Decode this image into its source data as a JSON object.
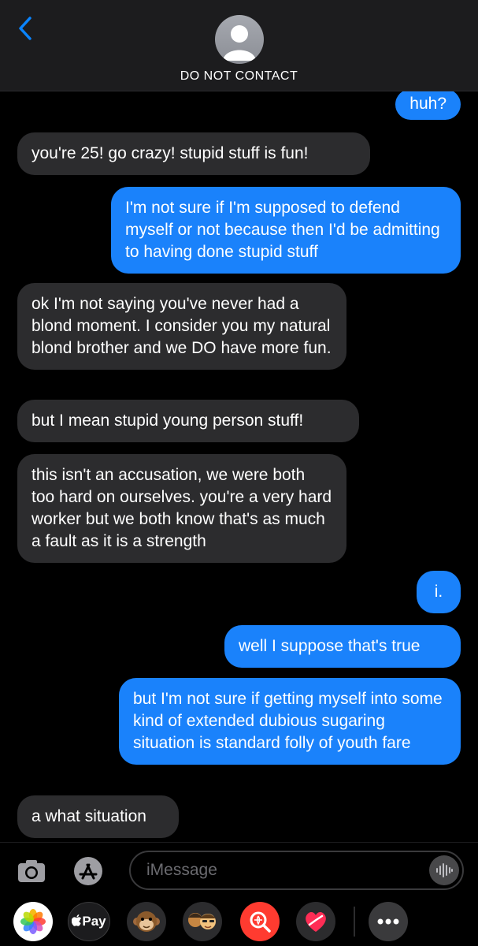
{
  "header": {
    "contact_name": "DO NOT CONTACT"
  },
  "messages": [
    {
      "from": "me",
      "text": "huh?"
    },
    {
      "from": "them",
      "text": "you're 25! go crazy! stupid stuff is fun!"
    },
    {
      "from": "me",
      "text": "I'm not sure if I'm supposed to defend myself or not because then I'd be admitting to having done stupid stuff"
    },
    {
      "from": "them",
      "text": "ok I'm not saying you've never had a blond moment. I consider you my natural blond brother and we DO have more fun."
    },
    {
      "from": "them",
      "text": "but I mean stupid young person stuff!"
    },
    {
      "from": "them",
      "text": "this isn't an accusation, we were both too hard on ourselves. you're a very hard worker but we both know that's as much a fault as it is a strength"
    },
    {
      "from": "me",
      "text": "i."
    },
    {
      "from": "me",
      "text": "well I suppose that's true"
    },
    {
      "from": "me",
      "text": "but I'm not sure if getting myself into some kind of extended dubious sugaring situation is standard folly of youth fare"
    },
    {
      "from": "them",
      "text": "a what situation"
    }
  ],
  "compose": {
    "placeholder": "iMessage"
  },
  "apps": {
    "apple_pay_label": "Pay"
  },
  "colors": {
    "outgoing_bubble": "#1a82fb",
    "incoming_bubble": "#2c2c2e",
    "header_bg": "#1c1c1e",
    "accent": "#0a84ff"
  },
  "icons": [
    "back-chevron-icon",
    "contact-avatar-icon",
    "camera-icon",
    "app-store-icon",
    "audio-waveform-icon",
    "photos-app-icon",
    "apple-pay-icon",
    "monkey-memoji-icon",
    "memoji-stickers-icon",
    "web-images-search-icon",
    "digital-touch-icon",
    "more-apps-icon"
  ]
}
